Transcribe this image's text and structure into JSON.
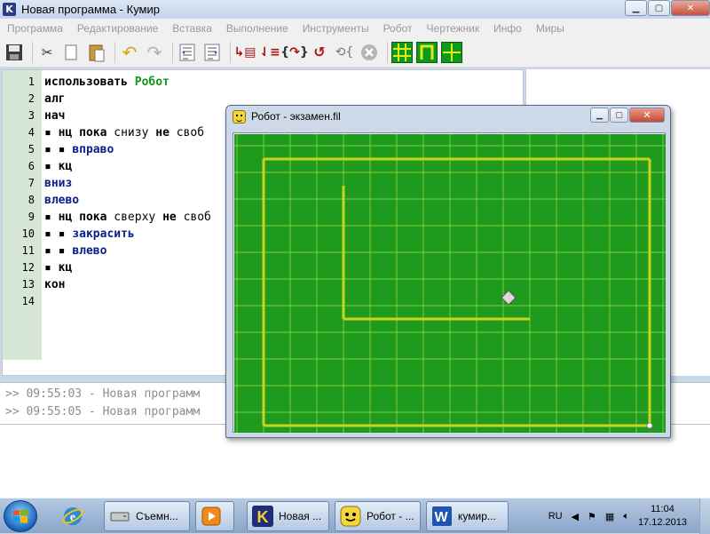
{
  "app": {
    "title": "Новая программа - Кумир",
    "icon_letter": "K"
  },
  "menu": [
    "Программа",
    "Редактирование",
    "Вставка",
    "Выполнение",
    "Инструменты",
    "Робот",
    "Чертежник",
    "Инфо",
    "Миры"
  ],
  "toolbar": {
    "icons": [
      "save-icon",
      "cut-icon",
      "copy-icon",
      "paste-icon",
      "undo-icon",
      "redo-icon",
      "indent-icon",
      "unindent-icon",
      "run-icon",
      "step-over-icon",
      "step-in-icon",
      "step-out-icon",
      "debug-icon",
      "stop-icon",
      "robot-grid-icon",
      "robot-walls-icon",
      "robot-cross-icon"
    ]
  },
  "editor": {
    "lines": [
      {
        "num": "1",
        "parts": [
          {
            "t": "использовать ",
            "c": "kw"
          },
          {
            "t": "Робот",
            "c": "green-t"
          }
        ]
      },
      {
        "num": "2",
        "parts": [
          {
            "t": "алг",
            "c": "kw"
          }
        ]
      },
      {
        "num": "3",
        "parts": [
          {
            "t": "нач",
            "c": "kw"
          }
        ]
      },
      {
        "num": "4",
        "parts": [
          {
            "t": "▪ нц пока ",
            "c": "kw"
          },
          {
            "t": "снизу",
            "c": "plain"
          },
          {
            "t": " не ",
            "c": "kw"
          },
          {
            "t": "своб",
            "c": "plain"
          }
        ]
      },
      {
        "num": "5",
        "parts": [
          {
            "t": "▪ ▪ ",
            "c": "kw"
          },
          {
            "t": "вправо",
            "c": "act"
          }
        ]
      },
      {
        "num": "6",
        "parts": [
          {
            "t": "▪ кц",
            "c": "kw"
          }
        ]
      },
      {
        "num": "7",
        "parts": [
          {
            "t": "вниз",
            "c": "act"
          }
        ]
      },
      {
        "num": "8",
        "parts": [
          {
            "t": "влево",
            "c": "act"
          }
        ]
      },
      {
        "num": "9",
        "parts": [
          {
            "t": "▪ нц пока ",
            "c": "kw"
          },
          {
            "t": "сверху",
            "c": "plain"
          },
          {
            "t": " не ",
            "c": "kw"
          },
          {
            "t": "своб",
            "c": "plain"
          }
        ]
      },
      {
        "num": "10",
        "parts": [
          {
            "t": "▪ ▪ ",
            "c": "kw"
          },
          {
            "t": "закрасить",
            "c": "act"
          }
        ]
      },
      {
        "num": "11",
        "parts": [
          {
            "t": "▪ ▪ ",
            "c": "kw"
          },
          {
            "t": "влево",
            "c": "act"
          }
        ]
      },
      {
        "num": "12",
        "parts": [
          {
            "t": "▪ кц",
            "c": "kw"
          }
        ]
      },
      {
        "num": "13",
        "parts": [
          {
            "t": "кон",
            "c": "kw"
          }
        ]
      },
      {
        "num": "14",
        "parts": []
      }
    ]
  },
  "console": {
    "lines": [
      ">> 09:55:03 - Новая программ",
      ">> 09:55:05 - Новая программ"
    ]
  },
  "robot_window": {
    "title": "Робот - экзамен.fil",
    "grid": {
      "cols": 16,
      "rows": 11
    },
    "field_color": "#1e9a1e",
    "wall_color": "#c8d41a"
  },
  "taskbar": {
    "buttons": [
      {
        "label": "Съемн...",
        "icon": "removable-drive-icon"
      },
      {
        "label": "",
        "icon": "media-player-icon"
      },
      {
        "label": "Новая ...",
        "icon": "kumir-icon"
      },
      {
        "label": "Робот - ...",
        "icon": "robot-icon"
      },
      {
        "label": "кумир...",
        "icon": "word-icon"
      }
    ],
    "lang": "RU",
    "time": "11:04",
    "date": "17.12.2013"
  }
}
